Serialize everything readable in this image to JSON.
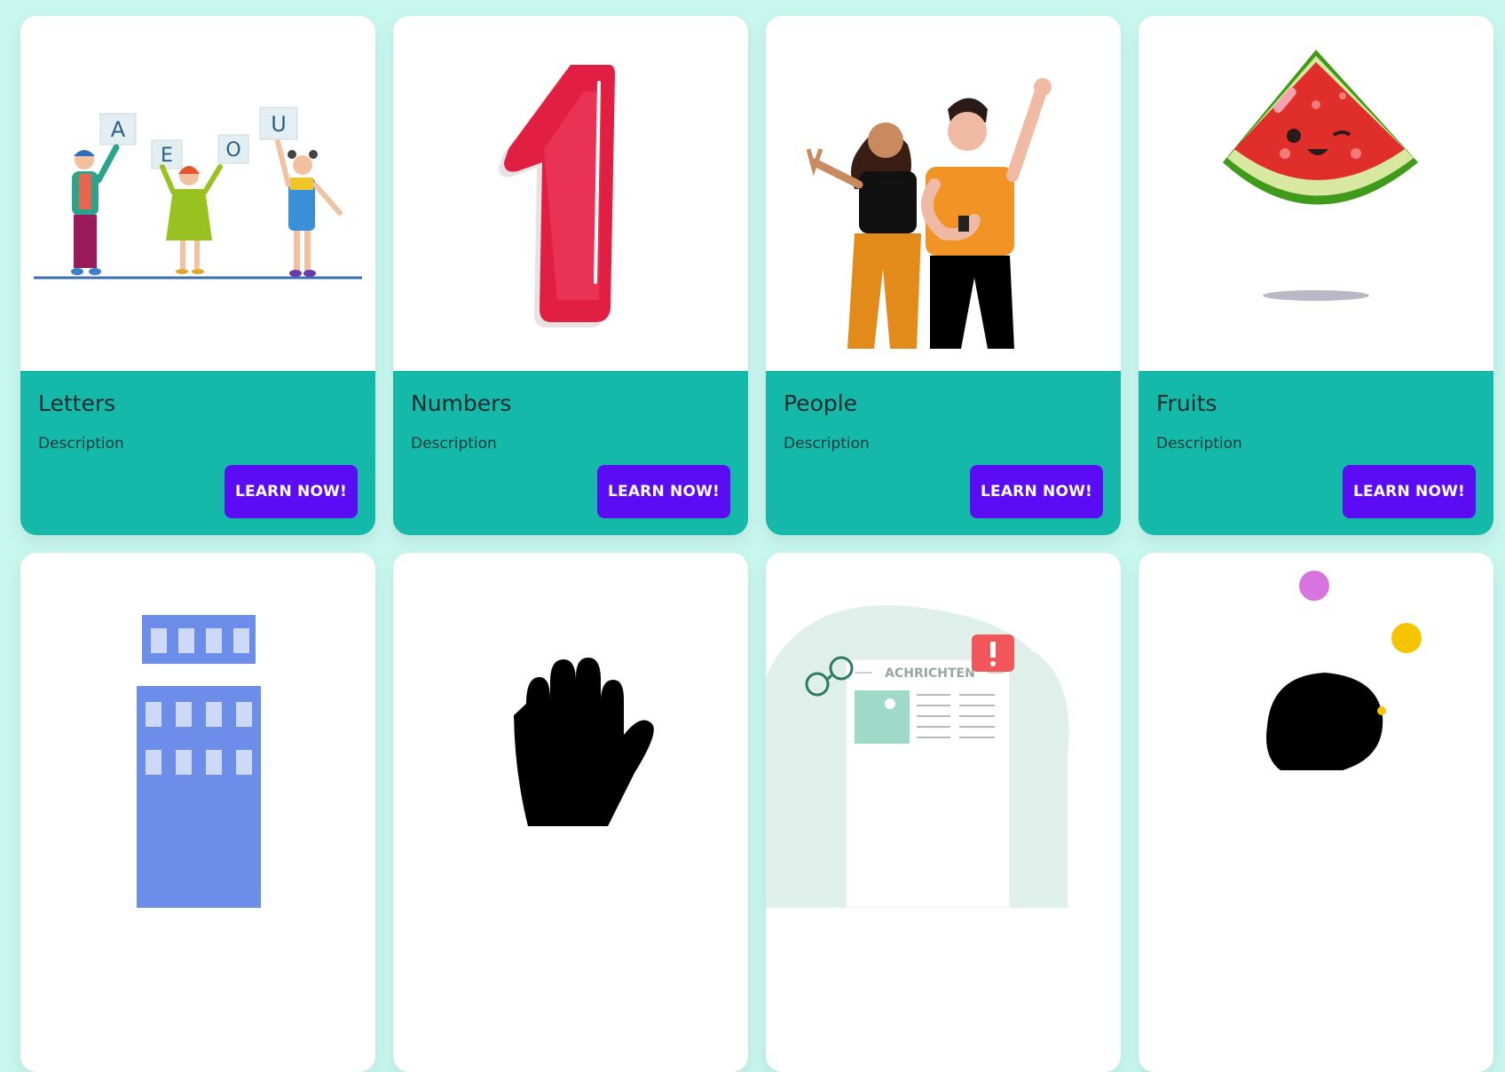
{
  "cards": [
    {
      "title": "Letters",
      "description": "Description",
      "button_label": "LEARN NOW!",
      "image": "children-holding-letter-signs-illustration",
      "letters": [
        "A",
        "E",
        "O",
        "U"
      ]
    },
    {
      "title": "Numbers",
      "description": "Description",
      "button_label": "LEARN NOW!",
      "image": "number-one-illustration"
    },
    {
      "title": "People",
      "description": "Description",
      "button_label": "LEARN NOW!",
      "image": "two-people-waving-illustration"
    },
    {
      "title": "Fruits",
      "description": "Description",
      "button_label": "LEARN NOW!",
      "image": "smiling-watermelon-slice-illustration"
    },
    {
      "title": "",
      "description": "",
      "button_label": "",
      "image": "buildings-illustration"
    },
    {
      "title": "",
      "description": "",
      "button_label": "",
      "image": "hand-silhouette-illustration"
    },
    {
      "title": "",
      "description": "",
      "button_label": "",
      "image": "newspaper-illustration",
      "newspaper_heading": "ACHRICHTEN"
    },
    {
      "title": "",
      "description": "",
      "button_label": "",
      "image": "black-blob-with-dots-illustration"
    }
  ],
  "colors": {
    "page_background": "#c8f7ee",
    "card_footer": "#15b9a9",
    "button": "#5b0cf5",
    "button_text": "#ffffff"
  }
}
